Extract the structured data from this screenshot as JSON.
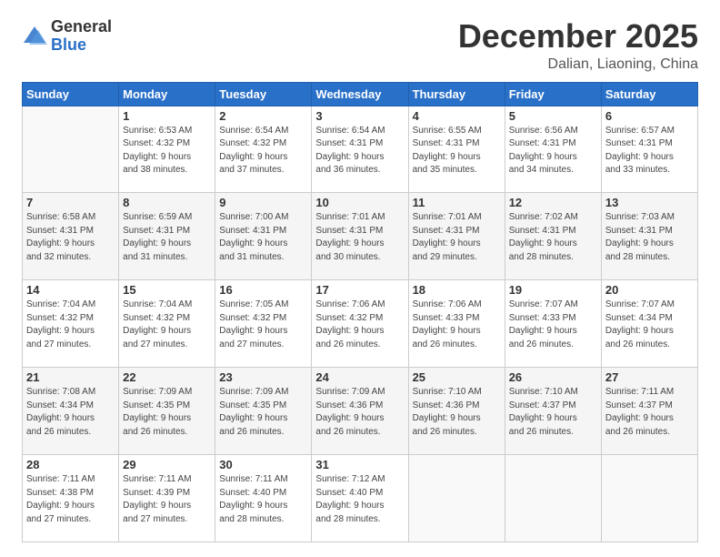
{
  "logo": {
    "general": "General",
    "blue": "Blue"
  },
  "header": {
    "month": "December 2025",
    "location": "Dalian, Liaoning, China"
  },
  "weekdays": [
    "Sunday",
    "Monday",
    "Tuesday",
    "Wednesday",
    "Thursday",
    "Friday",
    "Saturday"
  ],
  "weeks": [
    [
      {
        "day": "",
        "info": ""
      },
      {
        "day": "1",
        "info": "Sunrise: 6:53 AM\nSunset: 4:32 PM\nDaylight: 9 hours\nand 38 minutes."
      },
      {
        "day": "2",
        "info": "Sunrise: 6:54 AM\nSunset: 4:32 PM\nDaylight: 9 hours\nand 37 minutes."
      },
      {
        "day": "3",
        "info": "Sunrise: 6:54 AM\nSunset: 4:31 PM\nDaylight: 9 hours\nand 36 minutes."
      },
      {
        "day": "4",
        "info": "Sunrise: 6:55 AM\nSunset: 4:31 PM\nDaylight: 9 hours\nand 35 minutes."
      },
      {
        "day": "5",
        "info": "Sunrise: 6:56 AM\nSunset: 4:31 PM\nDaylight: 9 hours\nand 34 minutes."
      },
      {
        "day": "6",
        "info": "Sunrise: 6:57 AM\nSunset: 4:31 PM\nDaylight: 9 hours\nand 33 minutes."
      }
    ],
    [
      {
        "day": "7",
        "info": "Sunrise: 6:58 AM\nSunset: 4:31 PM\nDaylight: 9 hours\nand 32 minutes."
      },
      {
        "day": "8",
        "info": "Sunrise: 6:59 AM\nSunset: 4:31 PM\nDaylight: 9 hours\nand 31 minutes."
      },
      {
        "day": "9",
        "info": "Sunrise: 7:00 AM\nSunset: 4:31 PM\nDaylight: 9 hours\nand 31 minutes."
      },
      {
        "day": "10",
        "info": "Sunrise: 7:01 AM\nSunset: 4:31 PM\nDaylight: 9 hours\nand 30 minutes."
      },
      {
        "day": "11",
        "info": "Sunrise: 7:01 AM\nSunset: 4:31 PM\nDaylight: 9 hours\nand 29 minutes."
      },
      {
        "day": "12",
        "info": "Sunrise: 7:02 AM\nSunset: 4:31 PM\nDaylight: 9 hours\nand 28 minutes."
      },
      {
        "day": "13",
        "info": "Sunrise: 7:03 AM\nSunset: 4:31 PM\nDaylight: 9 hours\nand 28 minutes."
      }
    ],
    [
      {
        "day": "14",
        "info": "Sunrise: 7:04 AM\nSunset: 4:32 PM\nDaylight: 9 hours\nand 27 minutes."
      },
      {
        "day": "15",
        "info": "Sunrise: 7:04 AM\nSunset: 4:32 PM\nDaylight: 9 hours\nand 27 minutes."
      },
      {
        "day": "16",
        "info": "Sunrise: 7:05 AM\nSunset: 4:32 PM\nDaylight: 9 hours\nand 27 minutes."
      },
      {
        "day": "17",
        "info": "Sunrise: 7:06 AM\nSunset: 4:32 PM\nDaylight: 9 hours\nand 26 minutes."
      },
      {
        "day": "18",
        "info": "Sunrise: 7:06 AM\nSunset: 4:33 PM\nDaylight: 9 hours\nand 26 minutes."
      },
      {
        "day": "19",
        "info": "Sunrise: 7:07 AM\nSunset: 4:33 PM\nDaylight: 9 hours\nand 26 minutes."
      },
      {
        "day": "20",
        "info": "Sunrise: 7:07 AM\nSunset: 4:34 PM\nDaylight: 9 hours\nand 26 minutes."
      }
    ],
    [
      {
        "day": "21",
        "info": "Sunrise: 7:08 AM\nSunset: 4:34 PM\nDaylight: 9 hours\nand 26 minutes."
      },
      {
        "day": "22",
        "info": "Sunrise: 7:09 AM\nSunset: 4:35 PM\nDaylight: 9 hours\nand 26 minutes."
      },
      {
        "day": "23",
        "info": "Sunrise: 7:09 AM\nSunset: 4:35 PM\nDaylight: 9 hours\nand 26 minutes."
      },
      {
        "day": "24",
        "info": "Sunrise: 7:09 AM\nSunset: 4:36 PM\nDaylight: 9 hours\nand 26 minutes."
      },
      {
        "day": "25",
        "info": "Sunrise: 7:10 AM\nSunset: 4:36 PM\nDaylight: 9 hours\nand 26 minutes."
      },
      {
        "day": "26",
        "info": "Sunrise: 7:10 AM\nSunset: 4:37 PM\nDaylight: 9 hours\nand 26 minutes."
      },
      {
        "day": "27",
        "info": "Sunrise: 7:11 AM\nSunset: 4:37 PM\nDaylight: 9 hours\nand 26 minutes."
      }
    ],
    [
      {
        "day": "28",
        "info": "Sunrise: 7:11 AM\nSunset: 4:38 PM\nDaylight: 9 hours\nand 27 minutes."
      },
      {
        "day": "29",
        "info": "Sunrise: 7:11 AM\nSunset: 4:39 PM\nDaylight: 9 hours\nand 27 minutes."
      },
      {
        "day": "30",
        "info": "Sunrise: 7:11 AM\nSunset: 4:40 PM\nDaylight: 9 hours\nand 28 minutes."
      },
      {
        "day": "31",
        "info": "Sunrise: 7:12 AM\nSunset: 4:40 PM\nDaylight: 9 hours\nand 28 minutes."
      },
      {
        "day": "",
        "info": ""
      },
      {
        "day": "",
        "info": ""
      },
      {
        "day": "",
        "info": ""
      }
    ]
  ]
}
